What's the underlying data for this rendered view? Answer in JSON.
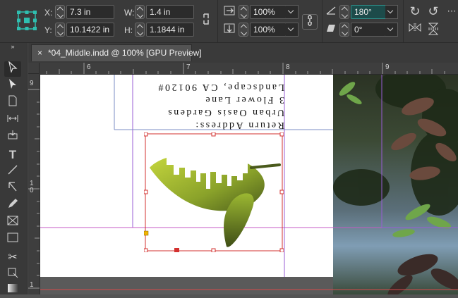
{
  "control": {
    "x_label": "X:",
    "x_value": "7.3 in",
    "y_label": "Y:",
    "y_value": "10.1422 in",
    "w_label": "W:",
    "w_value": "1.4 in",
    "h_label": "H:",
    "h_value": "1.1844 in",
    "scale_x": "100%",
    "scale_y": "100%",
    "rotation": "180°",
    "shear": "0°"
  },
  "tab": {
    "title": "*04_Middle.indd @ 100% [GPU Preview]",
    "close": "×"
  },
  "rulers": {
    "h_ticks": [
      "6",
      "7",
      "8",
      "9"
    ],
    "v_ticks": [
      "9",
      "1",
      "0",
      "1"
    ]
  },
  "document": {
    "address_lines": [
      "Return Address:",
      "Urban Oasis Gardens",
      "3 Flower Lane",
      "Landscape, CA 90120#"
    ]
  },
  "colors": {
    "frame": "#d3312f",
    "margin_guide": "#9a5cd6",
    "column_guide": "#7b8cc4",
    "leaf_light": "#b7cc3a",
    "leaf_dark": "#4a5a1c"
  }
}
